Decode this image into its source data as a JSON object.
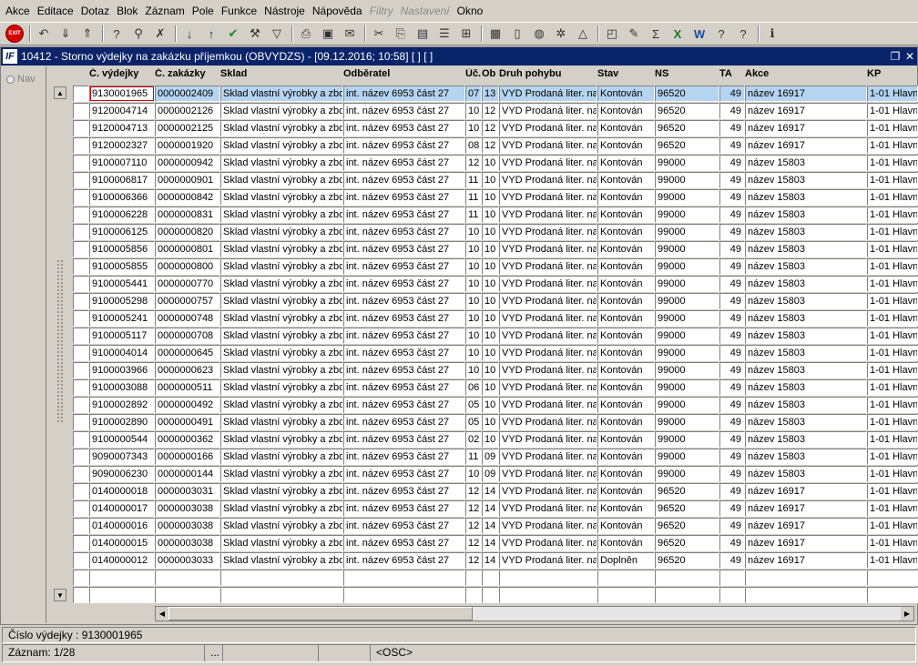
{
  "menu": [
    "Akce",
    "Editace",
    "Dotaz",
    "Blok",
    "Záznam",
    "Pole",
    "Funkce",
    "Nástroje",
    "Nápověda",
    "Filtry",
    "Nastavení",
    "Okno"
  ],
  "menu_disabled": [
    "Filtry",
    "Nastavení"
  ],
  "toolbar": {
    "exit_label": "EXIT",
    "icons": [
      "exit-icon",
      "sep",
      "undo-icon",
      "import-icon",
      "export-icon",
      "sep",
      "query-icon",
      "query-execute-icon",
      "query-cancel-icon",
      "sep",
      "sort-asc-icon",
      "sort-desc-icon",
      "check-icon",
      "wrench-icon",
      "filter-icon",
      "sep",
      "print-icon",
      "print-preview-icon",
      "mail-icon",
      "sep",
      "cut-icon",
      "copy-icon",
      "paste-icon",
      "list-icon",
      "tree-icon",
      "sep",
      "calendar-icon",
      "document-icon",
      "globe-icon",
      "gear-icon",
      "triangle-icon",
      "sep",
      "chart-icon",
      "edit-icon",
      "sum-icon",
      "excel-icon",
      "word-icon",
      "help-query-icon",
      "help-icon",
      "sep",
      "info-icon"
    ]
  },
  "window": {
    "app_icon": "IF",
    "title": "10412 - Storno výdejky na zakázku příjemkou (OBVYDZS) - [09.12.2016; 10:58]  [ ]  [ ]"
  },
  "nav_label": "Nav",
  "columns": [
    "Č. výdejky",
    "Č. zakázky",
    "Sklad",
    "Odběratel",
    "Úč.",
    "Ob",
    "Druh pohybu",
    "Stav",
    "NS",
    "TA",
    "Akce",
    "KP"
  ],
  "rows": [
    [
      "9130001965",
      "0000002409",
      "Sklad vlastní výrobky a zbo",
      "int. název 6953 část 27",
      "07",
      "13",
      "VYD Prodaná liter. na",
      "Kontován",
      "96520",
      "49",
      "název 16917",
      "1-01 Hlavní"
    ],
    [
      "9120004714",
      "0000002126",
      "Sklad vlastní výrobky a zbo",
      "int. název 6953 část 27",
      "10",
      "12",
      "VYD Prodaná liter. na",
      "Kontován",
      "96520",
      "49",
      "název 16917",
      "1-01 Hlavní"
    ],
    [
      "9120004713",
      "0000002125",
      "Sklad vlastní výrobky a zbo",
      "int. název 6953 část 27",
      "10",
      "12",
      "VYD Prodaná liter. na",
      "Kontován",
      "96520",
      "49",
      "název 16917",
      "1-01 Hlavní"
    ],
    [
      "9120002327",
      "0000001920",
      "Sklad vlastní výrobky a zbo",
      "int. název 6953 část 27",
      "08",
      "12",
      "VYD Prodaná liter. na",
      "Kontován",
      "96520",
      "49",
      "název 16917",
      "1-01 Hlavní"
    ],
    [
      "9100007110",
      "0000000942",
      "Sklad vlastní výrobky a zbo",
      "int. název 6953 část 27",
      "12",
      "10",
      "VYD Prodaná liter. na",
      "Kontován",
      "99000",
      "49",
      "název 15803",
      "1-01 Hlavní"
    ],
    [
      "9100006817",
      "0000000901",
      "Sklad vlastní výrobky a zbo",
      "int. název 6953 část 27",
      "11",
      "10",
      "VYD Prodaná liter. na",
      "Kontován",
      "99000",
      "49",
      "název 15803",
      "1-01 Hlavní"
    ],
    [
      "9100006366",
      "0000000842",
      "Sklad vlastní výrobky a zbo",
      "int. název 6953 část 27",
      "11",
      "10",
      "VYD Prodaná liter. na",
      "Kontován",
      "99000",
      "49",
      "název 15803",
      "1-01 Hlavní"
    ],
    [
      "9100006228",
      "0000000831",
      "Sklad vlastní výrobky a zbo",
      "int. název 6953 část 27",
      "11",
      "10",
      "VYD Prodaná liter. na",
      "Kontován",
      "99000",
      "49",
      "název 15803",
      "1-01 Hlavní"
    ],
    [
      "9100006125",
      "0000000820",
      "Sklad vlastní výrobky a zbo",
      "int. název 6953 část 27",
      "10",
      "10",
      "VYD Prodaná liter. na",
      "Kontován",
      "99000",
      "49",
      "název 15803",
      "1-01 Hlavní"
    ],
    [
      "9100005856",
      "0000000801",
      "Sklad vlastní výrobky a zbo",
      "int. název 6953 část 27",
      "10",
      "10",
      "VYD Prodaná liter. na",
      "Kontován",
      "99000",
      "49",
      "název 15803",
      "1-01 Hlavní"
    ],
    [
      "9100005855",
      "0000000800",
      "Sklad vlastní výrobky a zbo",
      "int. název 6953 část 27",
      "10",
      "10",
      "VYD Prodaná liter. na",
      "Kontován",
      "99000",
      "49",
      "název 15803",
      "1-01 Hlavní"
    ],
    [
      "9100005441",
      "0000000770",
      "Sklad vlastní výrobky a zbo",
      "int. název 6953 část 27",
      "10",
      "10",
      "VYD Prodaná liter. na",
      "Kontován",
      "99000",
      "49",
      "název 15803",
      "1-01 Hlavní"
    ],
    [
      "9100005298",
      "0000000757",
      "Sklad vlastní výrobky a zbo",
      "int. název 6953 část 27",
      "10",
      "10",
      "VYD Prodaná liter. na",
      "Kontován",
      "99000",
      "49",
      "název 15803",
      "1-01 Hlavní"
    ],
    [
      "9100005241",
      "0000000748",
      "Sklad vlastní výrobky a zbo",
      "int. název 6953 část 27",
      "10",
      "10",
      "VYD Prodaná liter. na",
      "Kontován",
      "99000",
      "49",
      "název 15803",
      "1-01 Hlavní"
    ],
    [
      "9100005117",
      "0000000708",
      "Sklad vlastní výrobky a zbo",
      "int. název 6953 část 27",
      "10",
      "10",
      "VYD Prodaná liter. na",
      "Kontován",
      "99000",
      "49",
      "název 15803",
      "1-01 Hlavní"
    ],
    [
      "9100004014",
      "0000000645",
      "Sklad vlastní výrobky a zbo",
      "int. název 6953 část 27",
      "10",
      "10",
      "VYD Prodaná liter. na",
      "Kontován",
      "99000",
      "49",
      "název 15803",
      "1-01 Hlavní"
    ],
    [
      "9100003966",
      "0000000623",
      "Sklad vlastní výrobky a zbo",
      "int. název 6953 část 27",
      "10",
      "10",
      "VYD Prodaná liter. na",
      "Kontován",
      "99000",
      "49",
      "název 15803",
      "1-01 Hlavní"
    ],
    [
      "9100003088",
      "0000000511",
      "Sklad vlastní výrobky a zbo",
      "int. název 6953 část 27",
      "06",
      "10",
      "VYD Prodaná liter. na",
      "Kontován",
      "99000",
      "49",
      "název 15803",
      "1-01 Hlavní"
    ],
    [
      "9100002892",
      "0000000492",
      "Sklad vlastní výrobky a zbo",
      "int. název 6953 část 27",
      "05",
      "10",
      "VYD Prodaná liter. na",
      "Kontován",
      "99000",
      "49",
      "název 15803",
      "1-01 Hlavní"
    ],
    [
      "9100002890",
      "0000000491",
      "Sklad vlastní výrobky a zbo",
      "int. název 6953 část 27",
      "05",
      "10",
      "VYD Prodaná liter. na",
      "Kontován",
      "99000",
      "49",
      "název 15803",
      "1-01 Hlavní"
    ],
    [
      "9100000544",
      "0000000362",
      "Sklad vlastní výrobky a zbo",
      "int. název 6953 část 27",
      "02",
      "10",
      "VYD Prodaná liter. na",
      "Kontován",
      "99000",
      "49",
      "název 15803",
      "1-01 Hlavní"
    ],
    [
      "9090007343",
      "0000000166",
      "Sklad vlastní výrobky a zbo",
      "int. název 6953 část 27",
      "11",
      "09",
      "VYD Prodaná liter. na",
      "Kontován",
      "99000",
      "49",
      "název 15803",
      "1-01 Hlavní"
    ],
    [
      "9090006230",
      "0000000144",
      "Sklad vlastní výrobky a zbo",
      "int. název 6953 část 27",
      "10",
      "09",
      "VYD Prodaná liter. na",
      "Kontován",
      "99000",
      "49",
      "název 15803",
      "1-01 Hlavní"
    ],
    [
      "0140000018",
      "0000003031",
      "Sklad vlastní výrobky a zbo",
      "int. název 6953 část 27",
      "12",
      "14",
      "VYD Prodaná liter. na",
      "Kontován",
      "96520",
      "49",
      "název 16917",
      "1-01 Hlavní"
    ],
    [
      "0140000017",
      "0000003038",
      "Sklad vlastní výrobky a zbo",
      "int. název 6953 část 27",
      "12",
      "14",
      "VYD Prodaná liter. na",
      "Kontován",
      "96520",
      "49",
      "název 16917",
      "1-01 Hlavní"
    ],
    [
      "0140000016",
      "0000003038",
      "Sklad vlastní výrobky a zbo",
      "int. název 6953 část 27",
      "12",
      "14",
      "VYD Prodaná liter. na",
      "Kontován",
      "96520",
      "49",
      "název 16917",
      "1-01 Hlavní"
    ],
    [
      "0140000015",
      "0000003038",
      "Sklad vlastní výrobky a zbo",
      "int. název 6953 část 27",
      "12",
      "14",
      "VYD Prodaná liter. na",
      "Kontován",
      "96520",
      "49",
      "název 16917",
      "1-01 Hlavní"
    ],
    [
      "0140000012",
      "0000003033",
      "Sklad vlastní výrobky a zbo",
      "int. název 6953 část 27",
      "12",
      "14",
      "VYD Prodaná liter. na",
      "Doplněn",
      "96520",
      "49",
      "název 16917",
      "1-01 Hlavní"
    ],
    [
      "",
      "",
      "",
      "",
      "",
      "",
      "",
      "",
      "",
      "",
      "",
      ""
    ],
    [
      "",
      "",
      "",
      "",
      "",
      "",
      "",
      "",
      "",
      "",
      "",
      ""
    ]
  ],
  "selected_row": 0,
  "status": {
    "field_value": "Číslo výdejky : 9130001965",
    "record": "Záznam: 1/28",
    "dots": "...",
    "mode": "<OSC>"
  },
  "colors": {
    "title_bar": "#0a246a",
    "selected_row": "#b5d4f0",
    "focus_outline": "#d00000",
    "exit_button": "#d40000"
  }
}
